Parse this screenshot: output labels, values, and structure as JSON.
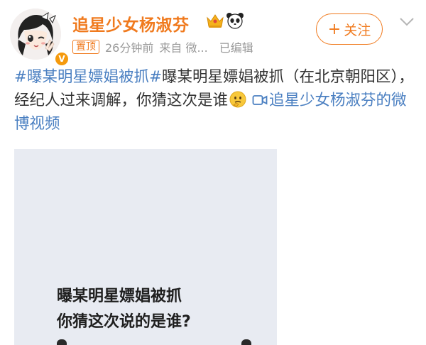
{
  "user": {
    "name": "追星少女杨淑芬",
    "verified_badge": "V",
    "avatar_icon": "anime-girl-avatar",
    "badges": [
      "crown-icon",
      "panda-icon"
    ]
  },
  "meta": {
    "pin_label": "置顶",
    "time": "26分钟前",
    "source": "来自 微...",
    "edited": "已编辑"
  },
  "follow": {
    "plus": "+",
    "label": "关注"
  },
  "post": {
    "hashtag": "#曝某明星嫖娼被抓#",
    "body": "曝某明星嫖娼被抓（在北京朝阳区），经纪人过来调解，你猜这次是谁",
    "emoji_icon": "thinking-face-icon",
    "video_link": "追星少女杨淑芬的微博视频"
  },
  "media": {
    "line1": "曝某明星嫖娼被抓",
    "line2": "你猜这次说的是谁?"
  },
  "colors": {
    "accent": "#f07a1e",
    "link": "#4a7fc1",
    "meta": "#999999",
    "media_bg": "#e8ebf2"
  }
}
